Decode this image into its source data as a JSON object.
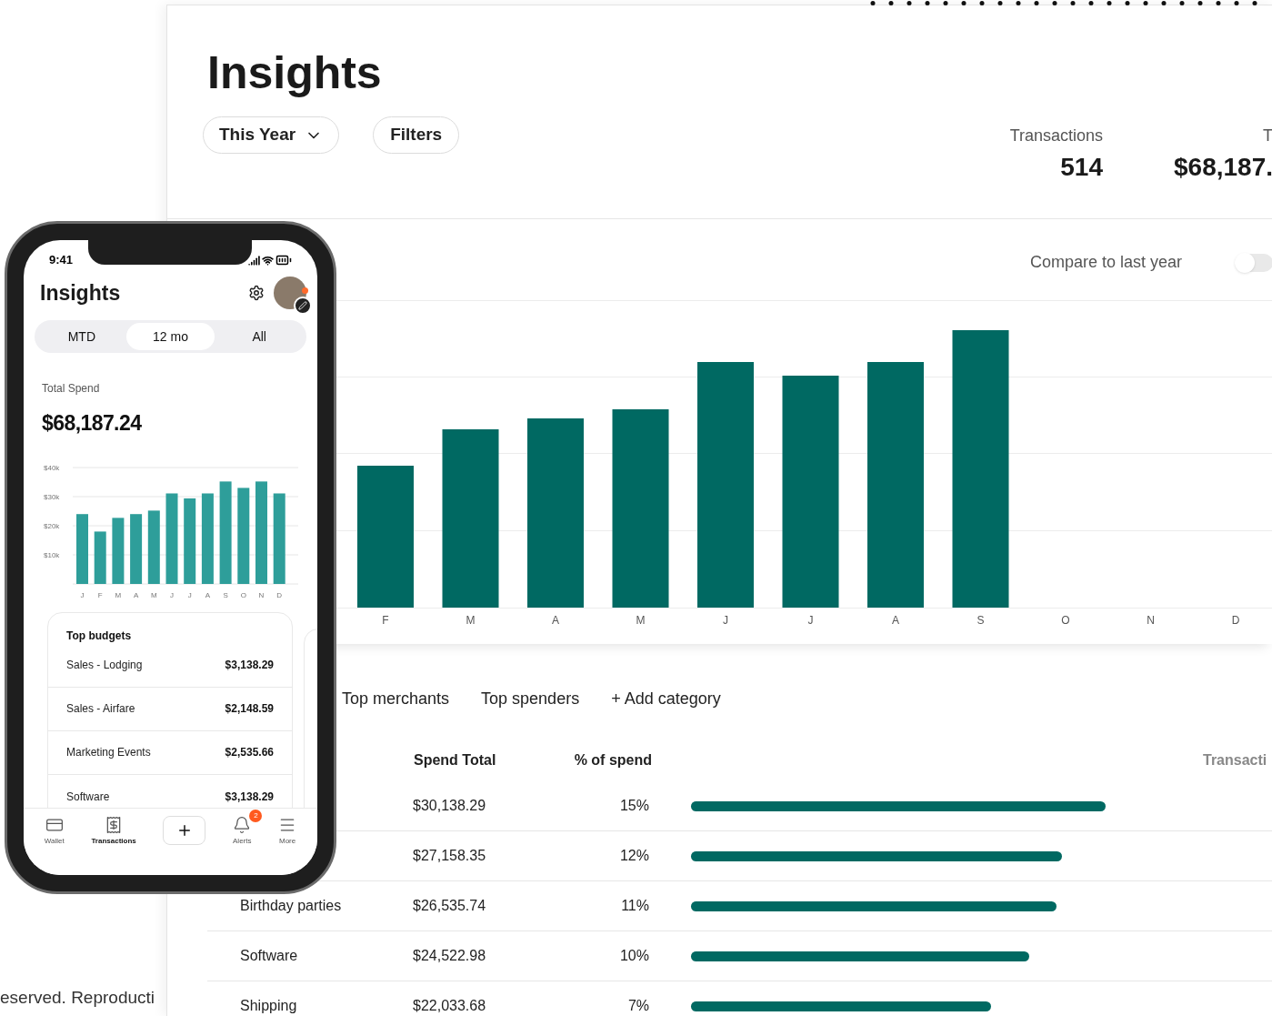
{
  "footer_text": "eserved. Reproducti",
  "desktop": {
    "title": "Insights",
    "period_button": "This Year",
    "filters_button": "Filters",
    "stats": [
      {
        "label": "Transactions",
        "value": "514"
      },
      {
        "label": "T",
        "value": "$68,187."
      }
    ],
    "compare": {
      "label": "Compare to last year",
      "on": false
    },
    "months": [
      "F",
      "M",
      "A",
      "M",
      "J",
      "J",
      "A",
      "S",
      "O",
      "N",
      "D"
    ],
    "category_tabs": [
      "Top merchants",
      "Top spenders",
      "+ Add category"
    ],
    "table": {
      "columns": [
        "Spend Total",
        "% of spend",
        "Transacti"
      ],
      "rows": [
        {
          "spend": "$30,138.29",
          "percent": "15%",
          "level": 0.76
        },
        {
          "spend": "$27,158.35",
          "percent": "12%",
          "level": 0.68
        },
        {
          "name": "Birthday parties",
          "spend": "$26,535.74",
          "percent": "11%",
          "level": 0.67
        },
        {
          "name": "Software",
          "spend": "$24,522.98",
          "percent": "10%",
          "level": 0.62
        },
        {
          "name": "Shipping",
          "spend": "$22,033.68",
          "percent": "7%",
          "level": 0.55
        }
      ]
    }
  },
  "phone": {
    "time": "9:41",
    "title": "Insights",
    "segments": [
      {
        "label": "MTD",
        "selected": false
      },
      {
        "label": "12 mo",
        "selected": true
      },
      {
        "label": "All",
        "selected": false
      }
    ],
    "total_label": "Total Spend",
    "total": "$68,187.24",
    "chart_data": {
      "type": "bar",
      "categories": [
        "J",
        "F",
        "M",
        "A",
        "M",
        "J",
        "J",
        "A",
        "S",
        "O",
        "N",
        "D"
      ],
      "grid": true,
      "series": [
        {
          "color": "#2e9e9a",
          "values": [
            24000,
            18000,
            22700,
            24000,
            25200,
            31100,
            29400,
            31100,
            35200,
            33000,
            35200,
            31100
          ]
        }
      ],
      "ylim": [
        0,
        40000
      ],
      "yticks": [
        {
          "value": 10000,
          "label": "$10k"
        },
        {
          "value": 20000,
          "label": "$20k"
        },
        {
          "value": 30000,
          "label": "$30k"
        },
        {
          "value": 40000,
          "label": "$40k"
        }
      ]
    },
    "budgets_title": "Top budgets",
    "budgets": [
      {
        "name": "Sales - Lodging",
        "amount": "$3,138.29"
      },
      {
        "name": "Sales - Airfare",
        "amount": "$2,148.59"
      },
      {
        "name": "Marketing Events",
        "amount": "$2,535.66"
      },
      {
        "name": "Software",
        "amount": "$3,138.29"
      }
    ],
    "nav": [
      {
        "kind": "wallet",
        "label": "Wallet",
        "selected": false
      },
      {
        "kind": "transactions",
        "label": "Transactions",
        "selected": true
      },
      {
        "kind": "add"
      },
      {
        "kind": "alerts",
        "label": "Alerts",
        "selected": false,
        "badge": "2"
      },
      {
        "kind": "more",
        "label": "More",
        "selected": false
      }
    ]
  }
}
